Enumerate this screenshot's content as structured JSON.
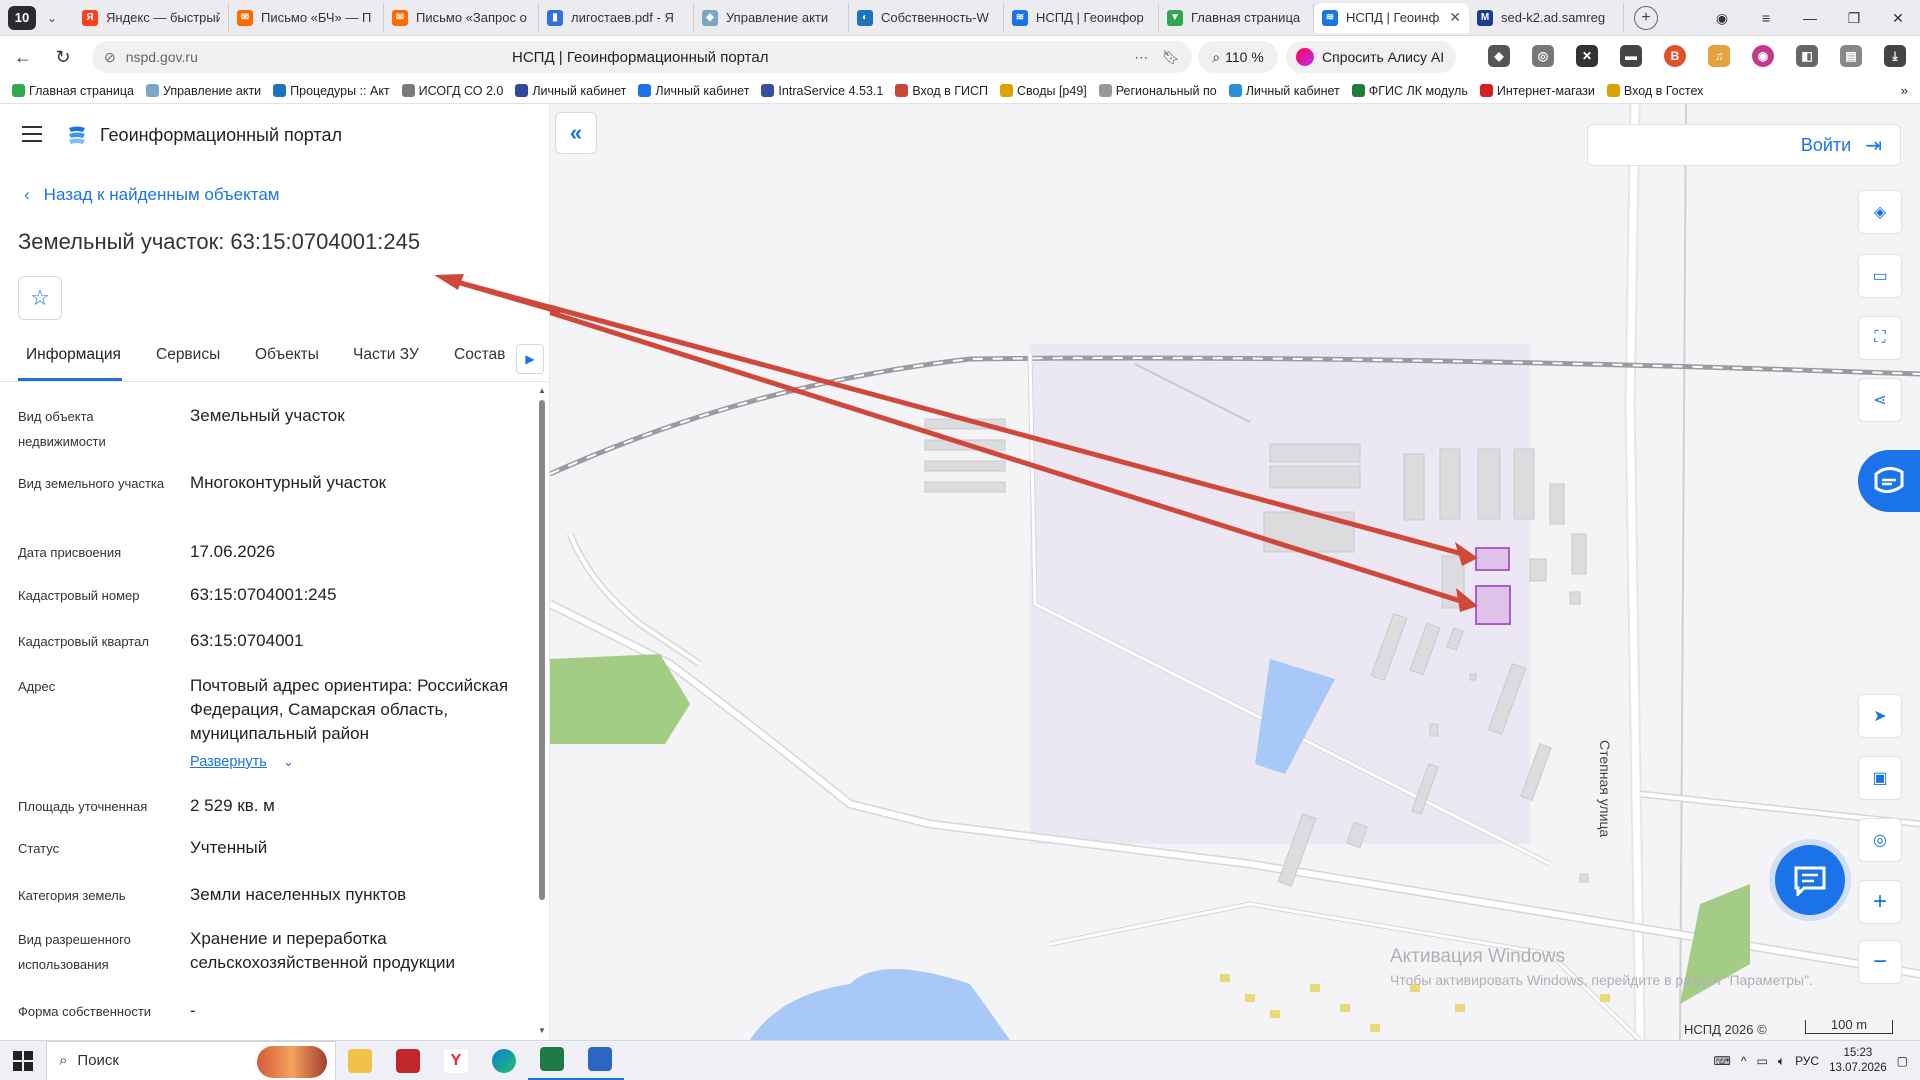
{
  "browser": {
    "tab_count": "10",
    "tabs": [
      {
        "title": "Яндекс — быстрый",
        "fav": "Я",
        "color": "#fc3f1d"
      },
      {
        "title": "Письмо «БЧ» — П",
        "fav": "✉",
        "color": "#ff6a00"
      },
      {
        "title": "Письмо «Запрос о",
        "fav": "✉",
        "color": "#ff6a00"
      },
      {
        "title": "лигостаев.pdf - Я",
        "fav": "▮",
        "color": "#2f6fe0"
      },
      {
        "title": "Управление акти",
        "fav": "◆",
        "color": "#7aa6c9"
      },
      {
        "title": "Собственность-W",
        "fav": "◐",
        "color": "#1c75bc"
      },
      {
        "title": "НСПД | Геоинфор",
        "fav": "≋",
        "color": "#1a73e8"
      },
      {
        "title": "Главная страница",
        "fav": "▼",
        "color": "#2fa84f"
      },
      {
        "title": "НСПД | Геоинф",
        "fav": "≋",
        "color": "#1a73e8",
        "active": true
      },
      {
        "title": "sed-k2.ad.samreg",
        "fav": "M",
        "color": "#1e3c8c"
      }
    ],
    "close_glyph": "✕",
    "new_tab_glyph": "+",
    "url": "nspd.gov.ru",
    "page_title": "НСПД | Геоинформационный портал",
    "zoom": "110 %",
    "alice": "Спросить Алису AI",
    "bookmarks": [
      {
        "label": "Главная страница",
        "color": "#2fa84f"
      },
      {
        "label": "Управление акти",
        "color": "#7aa6c9"
      },
      {
        "label": "Процедуры :: Акт",
        "color": "#1c75bc"
      },
      {
        "label": "ИСОГД СО 2.0",
        "color": "#7a7a7a"
      },
      {
        "label": "Личный кабинет",
        "color": "#33489c"
      },
      {
        "label": "Личный кабинет",
        "color": "#1a73e8"
      },
      {
        "label": "IntraService 4.53.1",
        "color": "#3a4ea0"
      },
      {
        "label": "Вход в ГИСП",
        "color": "#c43"
      },
      {
        "label": "Своды [р49]",
        "color": "#d9a300"
      },
      {
        "label": "Региональный по",
        "color": "#999"
      },
      {
        "label": "Личный кабинет",
        "color": "#2b8fd6"
      },
      {
        "label": "ФГИС ЛК модуль",
        "color": "#207a3a"
      },
      {
        "label": "Интернет-магази",
        "color": "#d41f26"
      },
      {
        "label": "Вход в Гостех",
        "color": "#d9a300"
      }
    ]
  },
  "portal": {
    "title": "Геоинформационный портал",
    "back_link": "Назад к найденным объектам",
    "object_title": "Земельный участок: 63:15:0704001:245",
    "tabs": [
      "Информация",
      "Сервисы",
      "Объекты",
      "Части ЗУ",
      "Состав"
    ],
    "info": [
      {
        "label": "Вид объекта недвижимости",
        "value": "Земельный участок"
      },
      {
        "label": "Вид земельного участка",
        "value": "Многоконтурный участок"
      },
      {
        "label": "Дата присвоения",
        "value": "17.06.2026"
      },
      {
        "label": "Кадастровый номер",
        "value": "63:15:0704001:245"
      },
      {
        "label": "Кадастровый квартал",
        "value": "63:15:0704001"
      },
      {
        "label": "Адрес",
        "value": "Почтовый адрес ориентира: Российская Федерация, Самарская область, муниципальный район"
      },
      {
        "label": "Площадь уточненная",
        "value": "2 529 кв. м"
      },
      {
        "label": "Статус",
        "value": "Учтенный"
      },
      {
        "label": "Категория земель",
        "value": "Земли населенных пунктов"
      },
      {
        "label": "Вид разрешенного использования",
        "value": "Хранение и переработка сельскохозяйственной продукции"
      },
      {
        "label": "Форма собственности",
        "value": "-"
      }
    ],
    "expand_label": "Развернуть"
  },
  "map": {
    "login": "Войти",
    "street": "Степная улица",
    "attribution": "НСПД 2026 ©",
    "scale": "100 m",
    "win_activate_title": "Активация Windows",
    "win_activate_text": "Чтобы активировать Windows, перейдите в раздел \"Параметры\".",
    "parcel_color": "#b05cc8",
    "arrow_color": "#d0483a"
  },
  "taskbar": {
    "search": "Поиск",
    "lang": "РУС",
    "time": "15:23",
    "date": "13.07.2026"
  }
}
